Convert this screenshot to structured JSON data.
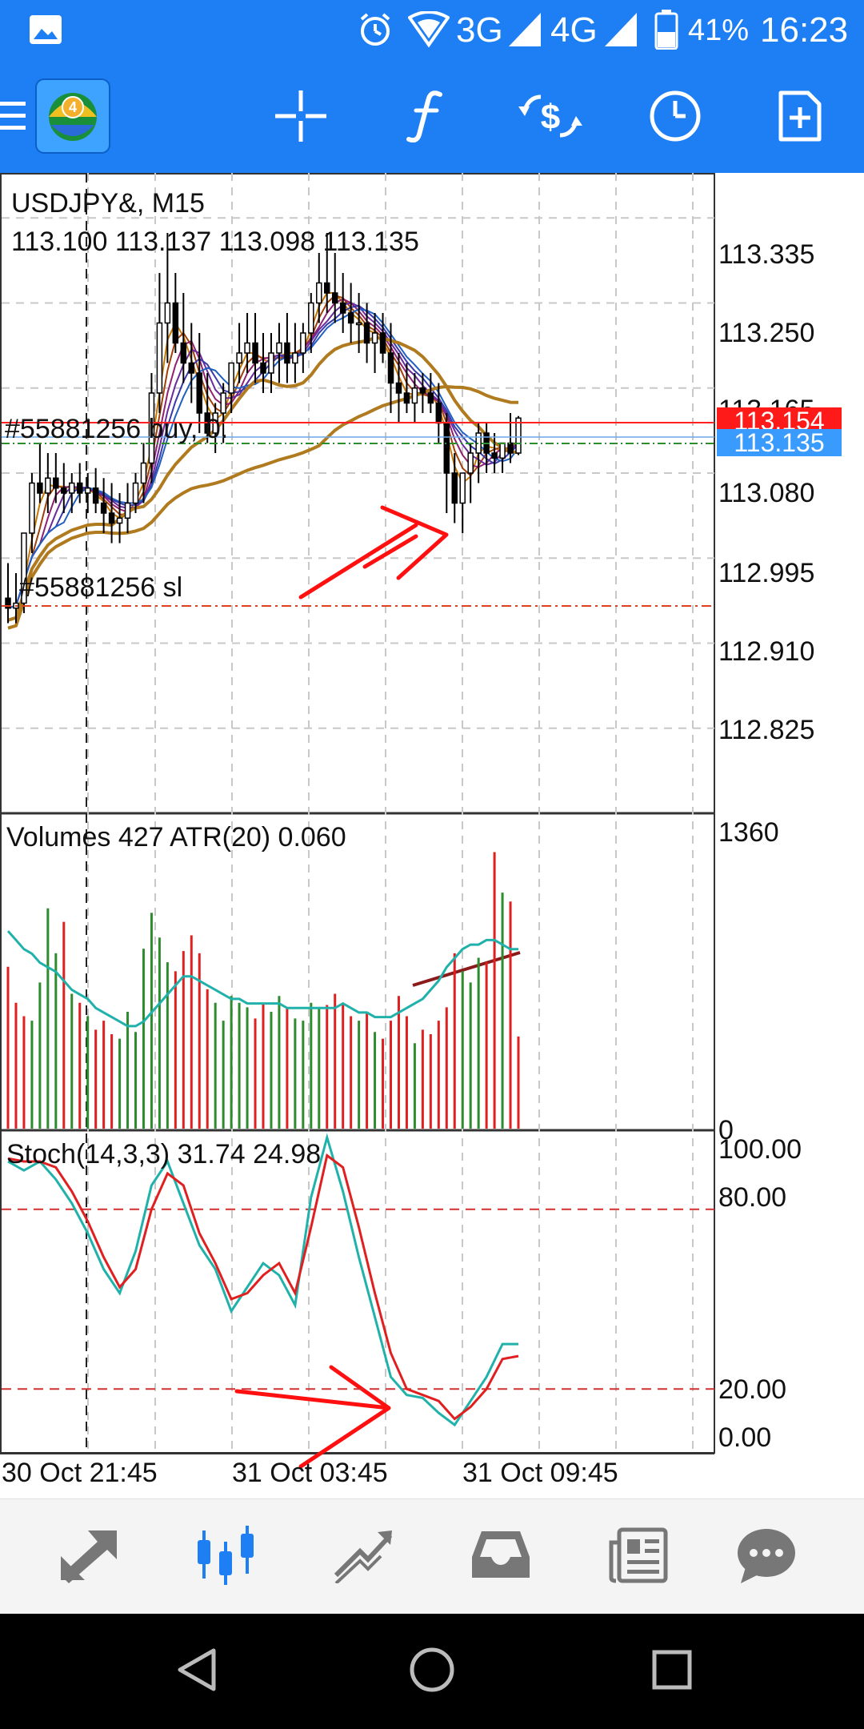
{
  "status_bar": {
    "network_3g": "3G",
    "network_4g": "4G",
    "battery": "41%",
    "time": "16:23"
  },
  "toolbar": {
    "icons": [
      "menu-icon",
      "metatrader-logo",
      "crosshair-icon",
      "indicators-icon",
      "trade-icon",
      "timeframe-icon",
      "new-order-icon"
    ]
  },
  "chart": {
    "symbol_label": "USDJPY&, M15",
    "ohlc_label": "113.100 113.137 113.098 113.135",
    "order_label": "#55881256 buy, 0.",
    "sl_label": "#55881256 sl",
    "red_tag": "113.154",
    "blue_tag": "113.135",
    "price_axis": [
      "113.335",
      "113.250",
      "113.165",
      "113.080",
      "112.995",
      "112.910",
      "112.825"
    ],
    "volume_label": "Volumes 427 ATR(20) 0.060",
    "volume_axis_max": "1360",
    "volume_axis_min": "0",
    "stoch_label": "Stoch(14,3,3) 31.74 24.98",
    "stoch_axis": [
      "100.00",
      "80.00",
      "20.00",
      "0.00"
    ],
    "time_axis": [
      "30 Oct 21:45",
      "31 Oct 03:45",
      "31 Oct 09:45"
    ]
  },
  "chart_data": [
    {
      "type": "candlestick",
      "title": "USDJPY&, M15",
      "ylim": [
        112.74,
        113.38
      ],
      "x": [
        0,
        1,
        2,
        3,
        4,
        5,
        6,
        7,
        8,
        9,
        10,
        11,
        12,
        13,
        14,
        15,
        16,
        17,
        18,
        19,
        20,
        21,
        22,
        23,
        24,
        25,
        26,
        27,
        28,
        29,
        30,
        31,
        32,
        33,
        34,
        35,
        36,
        37,
        38,
        39,
        40,
        41,
        42,
        43,
        44,
        45,
        46,
        47,
        48,
        49,
        50,
        51,
        52,
        53,
        54,
        55,
        56,
        57,
        58,
        59,
        60,
        61,
        62,
        63,
        64
      ],
      "open": [
        112.955,
        112.945,
        112.95,
        113.02,
        113.07,
        113.06,
        113.075,
        113.065,
        113.06,
        113.07,
        113.06,
        113.065,
        113.05,
        113.04,
        113.03,
        113.035,
        113.05,
        113.07,
        113.09,
        113.16,
        113.23,
        113.25,
        113.21,
        113.19,
        113.18,
        113.14,
        113.12,
        113.14,
        113.16,
        113.19,
        113.2,
        113.21,
        113.19,
        113.18,
        113.2,
        113.21,
        113.19,
        113.2,
        113.22,
        113.25,
        113.27,
        113.26,
        113.25,
        113.24,
        113.23,
        113.23,
        113.21,
        113.22,
        113.2,
        113.17,
        113.16,
        113.15,
        113.165,
        113.16,
        113.15,
        113.13,
        113.08,
        113.05,
        113.08,
        113.1,
        113.12,
        113.1,
        113.095,
        113.11,
        113.1
      ],
      "high": [
        112.99,
        112.98,
        113.01,
        113.08,
        113.11,
        113.1,
        113.1,
        113.09,
        113.08,
        113.09,
        113.08,
        113.085,
        113.075,
        113.07,
        113.06,
        113.07,
        113.08,
        113.11,
        113.18,
        113.28,
        113.32,
        113.28,
        113.26,
        113.23,
        113.22,
        113.18,
        113.15,
        113.17,
        113.19,
        113.23,
        113.24,
        113.24,
        113.22,
        113.22,
        113.23,
        113.24,
        113.23,
        113.23,
        113.26,
        113.3,
        113.32,
        113.3,
        113.28,
        113.27,
        113.26,
        113.25,
        113.24,
        113.24,
        113.23,
        113.2,
        113.19,
        113.18,
        113.18,
        113.18,
        113.17,
        113.14,
        113.1,
        113.08,
        113.11,
        113.13,
        113.13,
        113.12,
        113.11,
        113.14,
        113.137
      ],
      "low": [
        112.93,
        112.93,
        112.94,
        113.0,
        113.05,
        113.04,
        113.05,
        113.04,
        113.04,
        113.05,
        113.04,
        113.04,
        113.02,
        113.01,
        113.01,
        113.02,
        113.04,
        113.05,
        113.07,
        113.14,
        113.19,
        113.2,
        113.17,
        113.15,
        113.12,
        113.11,
        113.1,
        113.11,
        113.14,
        113.17,
        113.18,
        113.17,
        113.16,
        113.16,
        113.17,
        113.17,
        113.17,
        113.18,
        113.2,
        113.23,
        113.24,
        113.23,
        113.22,
        113.21,
        113.2,
        113.19,
        113.18,
        113.19,
        113.14,
        113.13,
        113.14,
        113.13,
        113.14,
        113.14,
        113.11,
        113.04,
        113.03,
        113.02,
        113.05,
        113.07,
        113.08,
        113.08,
        113.08,
        113.09,
        113.098
      ],
      "close": [
        112.945,
        112.95,
        113.02,
        113.07,
        113.06,
        113.075,
        113.065,
        113.06,
        113.07,
        113.06,
        113.065,
        113.05,
        113.04,
        113.03,
        113.035,
        113.05,
        113.07,
        113.09,
        113.16,
        113.23,
        113.25,
        113.21,
        113.19,
        113.18,
        113.14,
        113.12,
        113.14,
        113.16,
        113.19,
        113.2,
        113.21,
        113.19,
        113.18,
        113.2,
        113.21,
        113.19,
        113.2,
        113.22,
        113.25,
        113.27,
        113.26,
        113.25,
        113.24,
        113.23,
        113.23,
        113.21,
        113.22,
        113.2,
        113.17,
        113.16,
        113.15,
        113.165,
        113.16,
        113.15,
        113.13,
        113.08,
        113.05,
        113.08,
        113.1,
        113.12,
        113.1,
        113.095,
        113.11,
        113.1,
        113.135
      ]
    },
    {
      "type": "bar",
      "title": "Volumes 427 ATR(20) 0.060",
      "ylim": [
        0,
        1360
      ],
      "x": [
        0,
        1,
        2,
        3,
        4,
        5,
        6,
        7,
        8,
        9,
        10,
        11,
        12,
        13,
        14,
        15,
        16,
        17,
        18,
        19,
        20,
        21,
        22,
        23,
        24,
        25,
        26,
        27,
        28,
        29,
        30,
        31,
        32,
        33,
        34,
        35,
        36,
        37,
        38,
        39,
        40,
        41,
        42,
        43,
        44,
        45,
        46,
        47,
        48,
        49,
        50,
        51,
        52,
        53,
        54,
        55,
        56,
        57,
        58,
        59,
        60,
        61,
        62,
        63,
        64
      ],
      "values": [
        720,
        560,
        500,
        480,
        650,
        980,
        780,
        920,
        600,
        560,
        500,
        440,
        480,
        420,
        400,
        520,
        430,
        800,
        960,
        850,
        740,
        700,
        790,
        860,
        780,
        620,
        560,
        480,
        590,
        560,
        540,
        490,
        560,
        520,
        590,
        540,
        490,
        480,
        560,
        540,
        550,
        600,
        560,
        500,
        480,
        520,
        430,
        400,
        480,
        590,
        500,
        380,
        440,
        420,
        480,
        540,
        780,
        700,
        650,
        760,
        740,
        1230,
        1050,
        1010,
        410
      ],
      "up": [
        false,
        false,
        false,
        true,
        true,
        true,
        true,
        false,
        true,
        false,
        true,
        false,
        false,
        false,
        true,
        true,
        true,
        true,
        true,
        true,
        true,
        false,
        false,
        false,
        false,
        false,
        true,
        true,
        true,
        true,
        true,
        false,
        false,
        true,
        true,
        false,
        true,
        true,
        true,
        true,
        false,
        false,
        false,
        false,
        true,
        false,
        true,
        false,
        false,
        false,
        false,
        true,
        false,
        false,
        false,
        false,
        false,
        true,
        true,
        true,
        false,
        false,
        true,
        false,
        false
      ],
      "atr": [
        0.064,
        0.062,
        0.06,
        0.059,
        0.057,
        0.056,
        0.055,
        0.053,
        0.051,
        0.05,
        0.049,
        0.047,
        0.046,
        0.045,
        0.044,
        0.043,
        0.043,
        0.044,
        0.046,
        0.048,
        0.05,
        0.052,
        0.054,
        0.054,
        0.053,
        0.052,
        0.051,
        0.05,
        0.049,
        0.049,
        0.048,
        0.048,
        0.048,
        0.048,
        0.048,
        0.047,
        0.047,
        0.047,
        0.047,
        0.047,
        0.047,
        0.047,
        0.048,
        0.047,
        0.046,
        0.046,
        0.045,
        0.045,
        0.045,
        0.046,
        0.047,
        0.048,
        0.049,
        0.051,
        0.053,
        0.056,
        0.058,
        0.06,
        0.061,
        0.061,
        0.062,
        0.062,
        0.061,
        0.06,
        0.06
      ],
      "atr_ylim": [
        0.02,
        0.09
      ]
    },
    {
      "type": "line",
      "title": "Stoch(14,3,3) 31.74 24.98",
      "ylim": [
        0,
        100
      ],
      "x": [
        0,
        2,
        4,
        6,
        8,
        10,
        12,
        14,
        16,
        18,
        20,
        22,
        24,
        26,
        28,
        30,
        32,
        34,
        36,
        38,
        40,
        42,
        44,
        46,
        48,
        50,
        52,
        54,
        56,
        58,
        60,
        62,
        64
      ],
      "series": [
        {
          "name": "main",
          "values": [
            96,
            93,
            96,
            90,
            82,
            72,
            60,
            52,
            66,
            88,
            96,
            82,
            68,
            60,
            46,
            54,
            62,
            58,
            48,
            84,
            104,
            86,
            64,
            44,
            24,
            18,
            17,
            12,
            8,
            16,
            24,
            35,
            35
          ]
        },
        {
          "name": "signal",
          "values": [
            97,
            96,
            96,
            94,
            86,
            76,
            64,
            54,
            60,
            80,
            92,
            88,
            72,
            62,
            50,
            52,
            58,
            62,
            52,
            74,
            98,
            94,
            74,
            52,
            32,
            20,
            18,
            16,
            10,
            14,
            20,
            30,
            31
          ]
        }
      ],
      "levels": [
        80,
        20
      ]
    }
  ],
  "bottom_nav": {
    "items": [
      "quotes-icon",
      "chart-icon",
      "trade-icon",
      "history-icon",
      "news-icon",
      "messages-icon"
    ],
    "active": "chart-icon",
    "active_color": "#1e7ff5",
    "inactive_color": "#777777"
  },
  "colors": {
    "accent": "#1e7ff5",
    "bull": "#2e8b2e",
    "bear": "#e02020",
    "ma": "#b07a1e",
    "atr": "#20b2aa",
    "stoch_main": "#20b2aa",
    "stoch_signal": "#e02020"
  }
}
